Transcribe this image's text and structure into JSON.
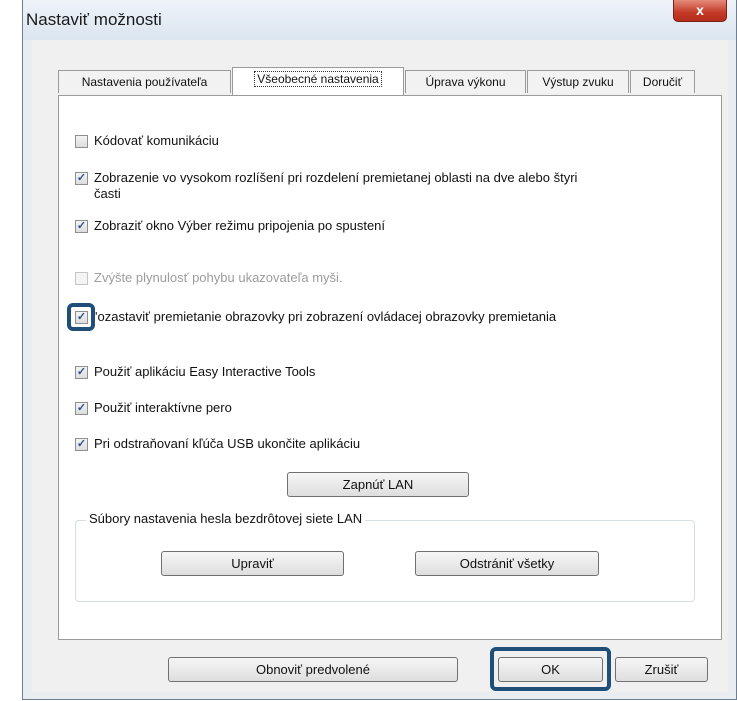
{
  "window": {
    "title": "Nastaviť možnosti",
    "close_symbol": "x"
  },
  "tabs": [
    {
      "label": "Nastavenia používateľa"
    },
    {
      "label": "Všeobecné nastavenia"
    },
    {
      "label": "Úprava výkonu"
    },
    {
      "label": "Výstup zvuku"
    },
    {
      "label": "Doručiť"
    }
  ],
  "active_tab": "Všeobecné nastavenia",
  "options": [
    {
      "label": "Kódovať komunikáciu",
      "checked": false,
      "enabled": true
    },
    {
      "label": "Zobrazenie vo vysokom rozlíšení pri rozdelení premietanej oblasti na dve alebo štyri",
      "label_line2": "časti",
      "checked": true,
      "enabled": true
    },
    {
      "label": "Zobraziť okno Výber režimu pripojenia po spustení",
      "checked": true,
      "enabled": true
    },
    {
      "label": "Zvýšte plynulosť pohybu ukazovateľa myši.",
      "checked": false,
      "enabled": false
    },
    {
      "label": "Pozastaviť premietanie obrazovky pri zobrazení ovládacej obrazovky premietania",
      "label_visible": "'ozastaviť premietanie obrazovky pri zobrazení ovládacej obrazovky  premietania",
      "checked": true,
      "enabled": true
    },
    {
      "label": "Použiť aplikáciu Easy Interactive Tools",
      "checked": true,
      "enabled": true
    },
    {
      "label": "Použiť interaktívne pero",
      "checked": true,
      "enabled": true
    },
    {
      "label": "Pri odstraňovaní kľúča USB ukončite aplikáciu",
      "checked": true,
      "enabled": true
    }
  ],
  "check_mark": "✓",
  "buttons": {
    "enable_lan": "Zapnúť LAN",
    "edit": "Upraviť",
    "delete_all": "Odstrániť všetky",
    "restore_defaults": "Obnoviť predvolené",
    "ok": "OK",
    "cancel": "Zrušiť"
  },
  "group": {
    "title": "Súbory nastavenia hesla bezdrôtovej siete LAN"
  },
  "colors": {
    "highlight": "#1f4e79",
    "close_button": "#c33a26",
    "window_frame": "#e9edf2"
  }
}
